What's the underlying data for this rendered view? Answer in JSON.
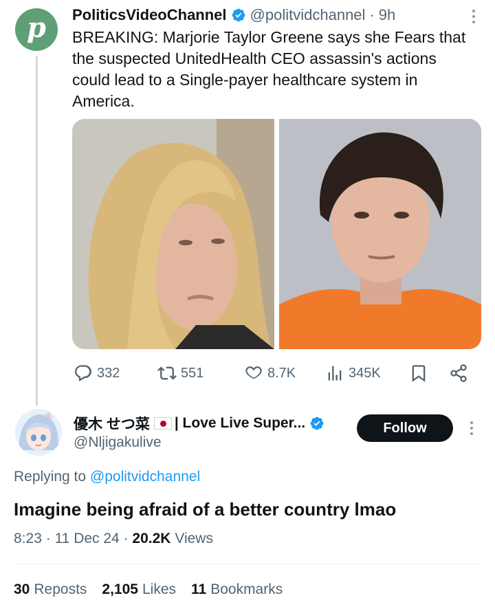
{
  "post": {
    "author_name": "PoliticsVideoChannel",
    "handle": "@politvidchannel",
    "separator": "·",
    "time": "9h",
    "avatar_letter": "p",
    "text": "BREAKING: Marjorie Taylor Greene says she Fears that the suspected UnitedHealth CEO assassin's actions could lead to a Single-payer healthcare system in America.",
    "actions": {
      "replies": "332",
      "reposts": "551",
      "likes": "8.7K",
      "views": "345K"
    }
  },
  "reply": {
    "author_name": "優木 せつ菜",
    "name_suffix": "| Love Live Super...",
    "handle": "@Nljigakulive",
    "follow_label": "Follow",
    "replying_prefix": "Replying to",
    "replying_to": "@politvidchannel",
    "text": "Imagine being afraid of a better country lmao",
    "time": "8:23",
    "date": "11 Dec 24",
    "views_count": "20.2K",
    "views_label": "Views",
    "dot": "·",
    "stats": {
      "reposts_count": "30",
      "reposts_label": "Reposts",
      "likes_count": "2,105",
      "likes_label": "Likes",
      "bookmarks_count": "11",
      "bookmarks_label": "Bookmarks"
    }
  },
  "colors": {
    "accent": "#1d9bf0",
    "muted": "#536471",
    "text": "#0f1419",
    "avatar_bg": "#5f9f78"
  }
}
